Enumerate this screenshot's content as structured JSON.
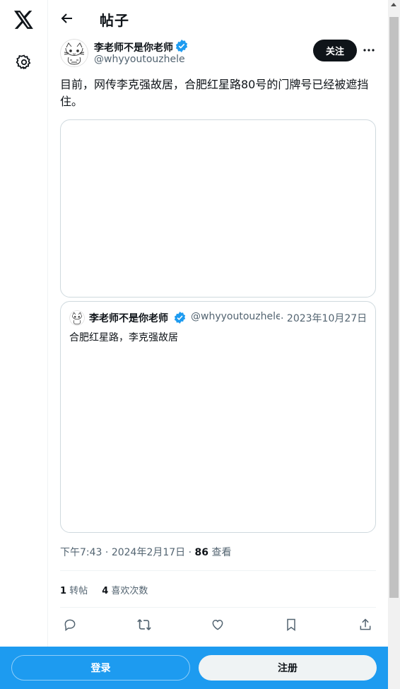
{
  "nav": {
    "logo_icon": "x-logo-icon",
    "settings_icon": "gear-icon"
  },
  "header": {
    "title": "帖子",
    "back_icon": "arrow-left-icon"
  },
  "post": {
    "display_name": "李老师不是你老师",
    "handle": "@whyyoutouzhele",
    "follow_label": "关注",
    "text": "目前，网传李克强故居，合肥红星路80号的门牌号已经被遮挡住。",
    "time": "下午7:43",
    "date": "2024年2月17日",
    "views_count": "86",
    "views_label": "查看",
    "retweets_count": "1",
    "retweets_label": "转帖",
    "likes_count": "4",
    "likes_label": "喜欢次数"
  },
  "quote": {
    "display_name": "李老师不是你老师",
    "handle": "@whyyoutouzhele",
    "date": "2023年10月27日",
    "text": "合肥红星路，李克强故居"
  },
  "actions": [
    "reply-icon",
    "retweet-icon",
    "like-icon",
    "bookmark-icon",
    "share-icon"
  ],
  "bottom": {
    "login_label": "登录",
    "signup_label": "注册"
  },
  "colors": {
    "accent": "#1d9bf0",
    "text": "#0f1419",
    "muted": "#536471",
    "border": "#cfd9de"
  }
}
